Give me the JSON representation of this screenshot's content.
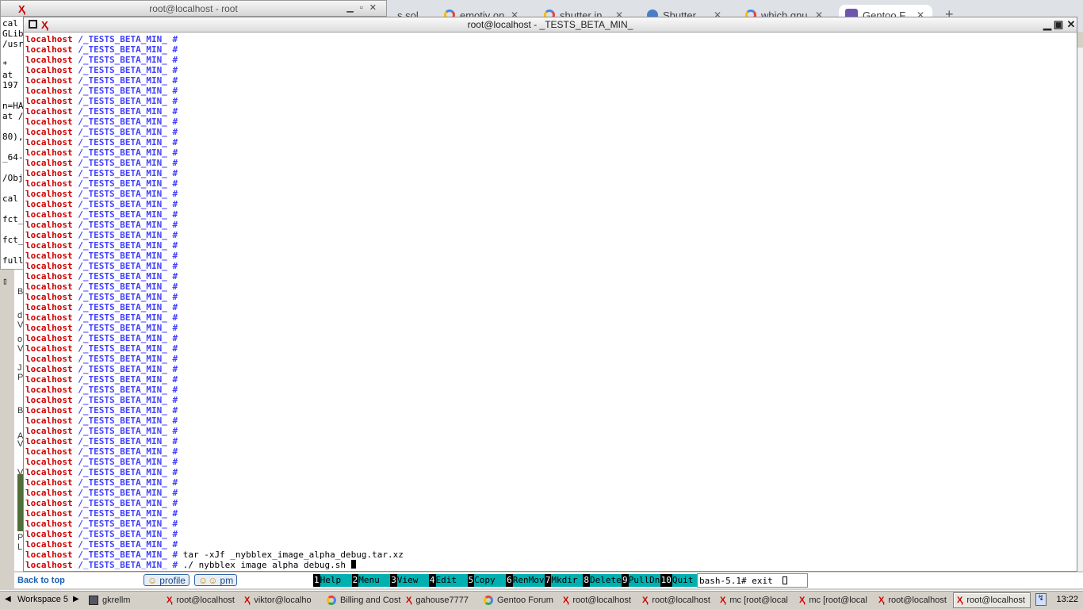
{
  "browser": {
    "tabs": [
      {
        "label": "…s sol"
      },
      {
        "label": "emotiv on"
      },
      {
        "label": "shutter in"
      },
      {
        "label": "Shutter"
      },
      {
        "label": "which gnu"
      },
      {
        "label": "Gentoo F"
      }
    ],
    "new_tab": "+"
  },
  "background_terminal": {
    "title": "root@localhost - root",
    "lines": [
      "cal",
      "GLib",
      "/usr",
      "",
      "*",
      "at",
      "197",
      "",
      "n=HA",
      "at /",
      "",
      "80),",
      "",
      "_64-",
      "",
      "/Obj",
      "",
      "cal",
      "",
      "fct_",
      "",
      "fct_",
      "",
      "full",
      ""
    ]
  },
  "page_fragments": {
    "letters": [
      "B",
      "d",
      "V",
      "o",
      "V",
      "J",
      "P",
      "B",
      "A",
      "V",
      "V",
      "J",
      "P",
      "L"
    ],
    "back_to_top": "Back to top",
    "profile_button": "profile",
    "pm_button": "pm"
  },
  "terminal": {
    "title": "root@localhost - _TESTS_BETA_MIN_",
    "host": "localhost",
    "path": "/_TESTS_BETA_MIN_",
    "prompt_symbol": "#",
    "empty_prompt_count": 50,
    "commands": [
      "tar -xJf _nybblex_image_alpha_debug.tar.xz",
      "./_nybblex_image_alpha_debug.sh"
    ]
  },
  "mc_function_keys": [
    {
      "num": "1",
      "label": "Help"
    },
    {
      "num": "2",
      "label": "Menu"
    },
    {
      "num": "3",
      "label": "View"
    },
    {
      "num": "4",
      "label": "Edit"
    },
    {
      "num": "5",
      "label": "Copy"
    },
    {
      "num": "6",
      "label": "RenMov"
    },
    {
      "num": "7",
      "label": "Mkdir"
    },
    {
      "num": "8",
      "label": "Delete"
    },
    {
      "num": "9",
      "label": "PullDn"
    },
    {
      "num": "10",
      "label": "Quit"
    }
  ],
  "mc_prompt": "bash-5.1# exit",
  "taskbar": {
    "workspace": "Workspace 5",
    "tasks": [
      {
        "label": "gkrellm",
        "icon": "gkrellm-icon"
      },
      {
        "label": "root@localhost",
        "icon": "x-terminal-icon"
      },
      {
        "label": "viktor@localho",
        "icon": "x-terminal-icon"
      },
      {
        "label": "Billing and Cost",
        "icon": "chrome-icon"
      },
      {
        "label": "gahouse7777",
        "icon": "x-terminal-icon"
      },
      {
        "label": "Gentoo Forum",
        "icon": "chrome-icon"
      },
      {
        "label": "root@localhost",
        "icon": "x-terminal-icon"
      },
      {
        "label": "root@localhost",
        "icon": "x-terminal-icon"
      },
      {
        "label": "mc [root@local",
        "icon": "x-terminal-icon"
      },
      {
        "label": "mc [root@local",
        "icon": "x-terminal-icon"
      },
      {
        "label": "root@localhost",
        "icon": "x-terminal-icon"
      },
      {
        "label": "root@localhost",
        "icon": "x-terminal-icon"
      }
    ],
    "clock": "13:22"
  }
}
